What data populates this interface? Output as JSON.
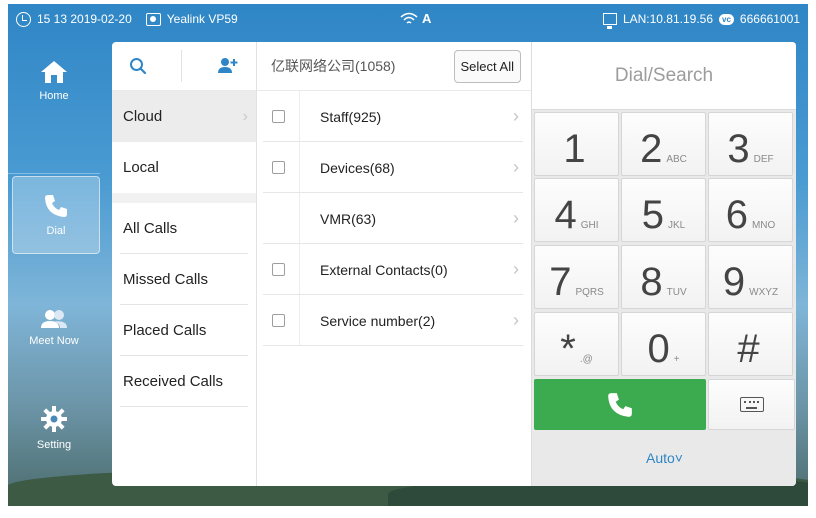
{
  "status_bar": {
    "time_date": "15 13 2019-02-20",
    "device": "Yealink VP59",
    "font_icon": "A",
    "lan": "LAN:10.81.19.56",
    "account": "666661001"
  },
  "nav": {
    "items": [
      {
        "label": "Home",
        "icon": "home-icon"
      },
      {
        "label": "Dial",
        "icon": "phone-icon"
      },
      {
        "label": "Meet Now",
        "icon": "people-icon"
      },
      {
        "label": "Setting",
        "icon": "gear-icon"
      }
    ],
    "active": "Dial"
  },
  "categories": {
    "top": [
      {
        "label": "Cloud"
      },
      {
        "label": "Local"
      }
    ],
    "history": [
      {
        "label": "All Calls"
      },
      {
        "label": "Missed Calls"
      },
      {
        "label": "Placed Calls"
      },
      {
        "label": "Received Calls"
      }
    ]
  },
  "directory": {
    "title": "亿联网络公司(1058)",
    "select_all": "Select All",
    "rows": [
      {
        "label": "Staff(925)",
        "checkbox": true
      },
      {
        "label": "Devices(68)",
        "checkbox": true
      },
      {
        "label": "VMR(63)",
        "checkbox": false
      },
      {
        "label": "External Contacts(0)",
        "checkbox": true
      },
      {
        "label": "Service number(2)",
        "checkbox": true
      }
    ]
  },
  "dialpad": {
    "placeholder": "Dial/Search",
    "keys": [
      {
        "num": "1",
        "sub": ""
      },
      {
        "num": "2",
        "sub": "ABC"
      },
      {
        "num": "3",
        "sub": "DEF"
      },
      {
        "num": "4",
        "sub": "GHI"
      },
      {
        "num": "5",
        "sub": "JKL"
      },
      {
        "num": "6",
        "sub": "MNO"
      },
      {
        "num": "7",
        "sub": "PQRS"
      },
      {
        "num": "8",
        "sub": "TUV"
      },
      {
        "num": "9",
        "sub": "WXYZ"
      },
      {
        "num": "*",
        "sub": ".@"
      },
      {
        "num": "0",
        "sub": "+"
      },
      {
        "num": "#",
        "sub": ""
      }
    ],
    "mode": "Auto˅"
  },
  "colors": {
    "accent": "#2f86c6",
    "call": "#3caa4f"
  }
}
